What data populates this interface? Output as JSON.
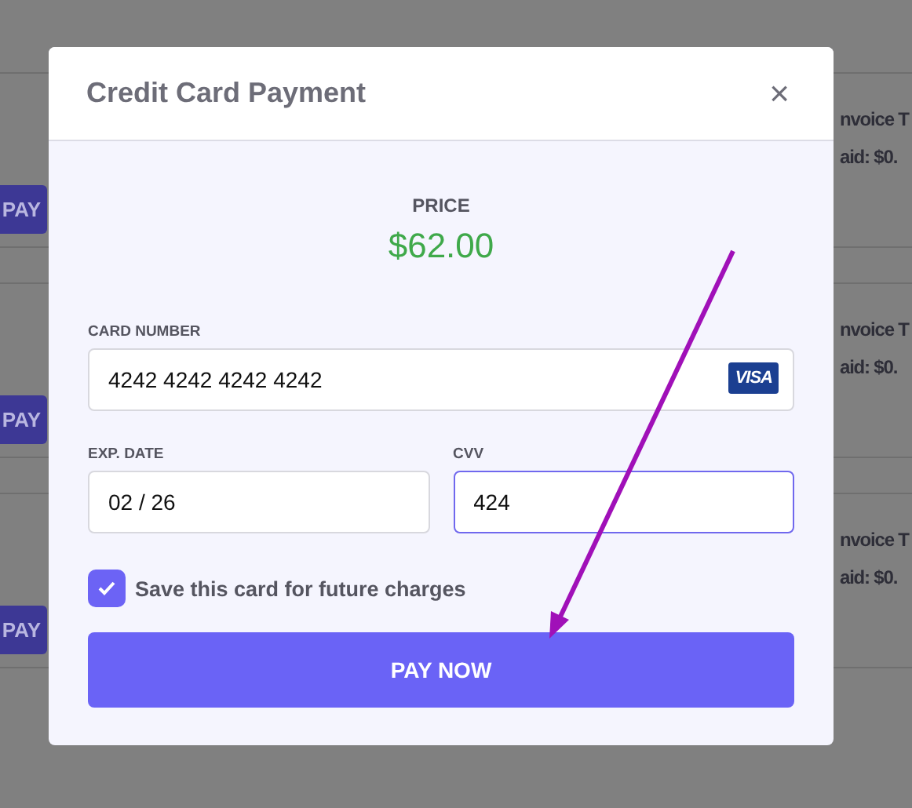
{
  "background": {
    "rows": [
      {
        "pay_button": "PAY",
        "text_1": "nvoice T",
        "text_2": "aid: $0."
      },
      {
        "pay_button": "PAY",
        "text_1": "nvoice T",
        "text_2": "aid: $0."
      },
      {
        "pay_button": "PAY",
        "text_1": "nvoice T",
        "text_2": "aid: $0."
      }
    ]
  },
  "modal": {
    "title": "Credit Card Payment",
    "close": "×",
    "price_label": "PRICE",
    "price": "$62.00",
    "card_number": {
      "label": "CARD NUMBER",
      "value": "4242 4242 4242 4242",
      "brand": "VISA",
      "focused": false
    },
    "expiry": {
      "label": "EXP. DATE",
      "value": "02 / 26",
      "focused": false
    },
    "cvv": {
      "label": "CVV",
      "value": "424",
      "focused": true
    },
    "save_card": {
      "label": "Save this card for future charges",
      "checked": true
    },
    "submit": "PAY NOW"
  }
}
